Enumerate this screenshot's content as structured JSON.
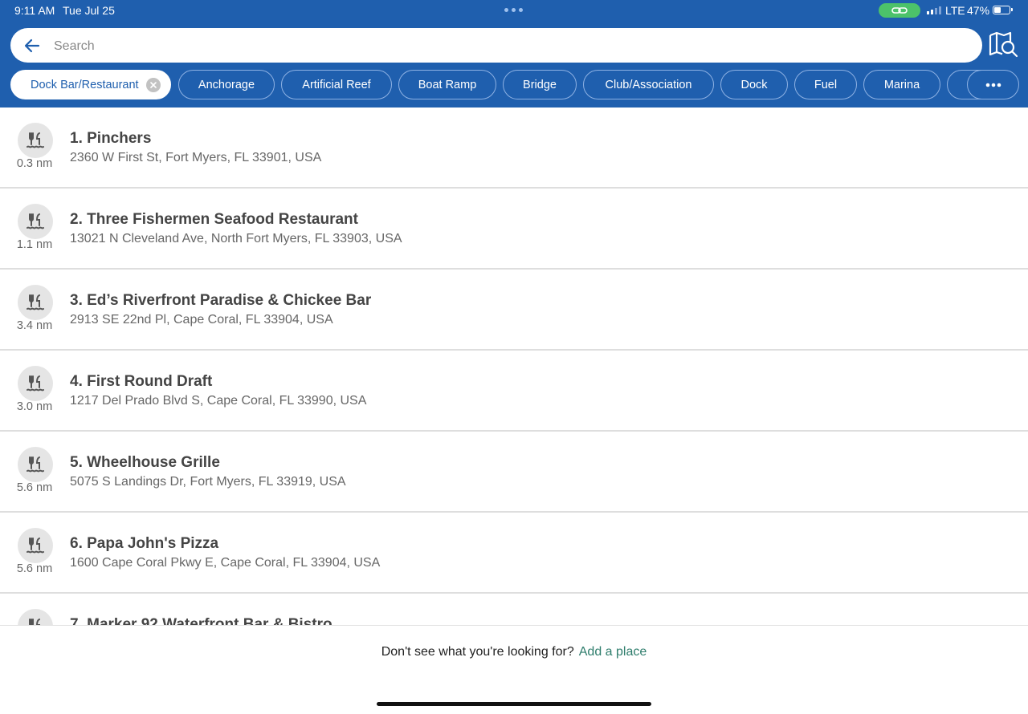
{
  "status_bar": {
    "time": "9:11 AM",
    "date": "Tue Jul 25",
    "network": "LTE",
    "battery_text": "47%",
    "battery_level": 0.47
  },
  "search": {
    "placeholder": "Search",
    "back_icon": "back-arrow-icon",
    "map_icon": "map-search-icon"
  },
  "filters": {
    "active": "Dock Bar/Restaurant",
    "chips": [
      "Anchorage",
      "Artificial Reef",
      "Boat Ramp",
      "Bridge",
      "Club/Association",
      "Dock",
      "Fuel",
      "Marina"
    ],
    "more_icon": "more-horizontal-icon"
  },
  "results": [
    {
      "name": "1. Pinchers",
      "address": "2360 W First St, Fort Myers, FL 33901, USA",
      "distance": "0.3 nm"
    },
    {
      "name": "2. Three Fishermen Seafood Restaurant",
      "address": "13021 N Cleveland Ave, North Fort Myers, FL 33903, USA",
      "distance": "1.1 nm"
    },
    {
      "name": "3. Ed’s Riverfront Paradise & Chickee Bar",
      "address": "2913 SE 22nd Pl, Cape Coral, FL 33904, USA",
      "distance": "3.4 nm"
    },
    {
      "name": "4. First Round Draft",
      "address": "1217 Del Prado Blvd S, Cape Coral, FL 33990, USA",
      "distance": "3.0 nm"
    },
    {
      "name": "5. Wheelhouse Grille",
      "address": "5075 S Landings Dr, Fort Myers, FL 33919, USA",
      "distance": "5.6 nm"
    },
    {
      "name": "6. Papa John's Pizza",
      "address": "1600 Cape Coral Pkwy E, Cape Coral, FL 33904, USA",
      "distance": "5.6 nm"
    },
    {
      "name": "7. Marker 92 Waterfront Bar & Bistro",
      "address": "",
      "distance": ""
    }
  ],
  "footer": {
    "prompt": "Don't see what you're looking for?",
    "link": "Add a place"
  },
  "colors": {
    "header": "#1f5fae",
    "link": "#2e7d6c"
  }
}
